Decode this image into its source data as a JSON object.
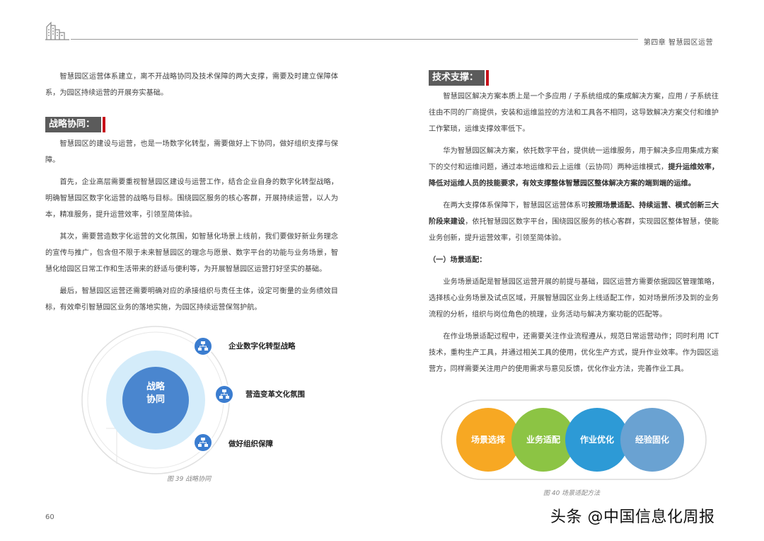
{
  "header": {
    "chapter": "第四章  智慧园区运营"
  },
  "left": {
    "intro": "智慧园区运营体系建立，离不开战略协同及技术保障的两大支撑，需要及时建立保障体系，为园区持续运营的开展夯实基础。",
    "section_title": "战略协同：",
    "p1": "智慧园区的建设与运营，也是一场数字化转型，需要做好上下协同，做好组织支撑与保障。",
    "p2": "首先，企业高层需要重视智慧园区建设与运营工作，结合企业自身的数字化转型战略，明确智慧园区数字化运营的战略与目标。围绕园区服务的核心客群，开展持续运营，以人为本，精准服务，提升运营效率，引领至简体验。",
    "p3": "其次，需要营造数字化运营的文化氛围，如智慧化场景上线前，我们要做好新业务理念的宣传与推广，包含但不限于未来智慧园区的理念与愿景、数字平台的功能与业务场景，智慧化给园区日常工作和生活带来的舒适与便利等，为开展智慧园区运营打好坚实的基础。",
    "p4": "最后，智慧园区运营还需要明确对应的承接组织与责任主体，设定可衡量的业务绩效目标，有效牵引智慧园区业务的落地实施，为园区持续运营保驾护航。"
  },
  "diagram1": {
    "center_label": "战略协同",
    "items": [
      "企业数字化转型战略",
      "营造变革文化氛围",
      "做好组织保障"
    ],
    "caption": "图 39 战略协同"
  },
  "right": {
    "section_title": "技术支撑：",
    "p1": "智慧园区解决方案本质上是一个多应用 / 子系统组成的集成解决方案，应用 / 子系统往往由不同的厂商提供，安装和运维监控的方法和工具各不相同，这导致解决方案交付和维护工作繁琐，运维支撑效率低下。",
    "p2_a": "华为智慧园区解决方案，依托数字平台，提供统一运维服务，用于解决多应用集成方案下的交付和运维问题，通过本地运维和云上运维（云协同）两种运维模式，",
    "p2_b": "提升运维效率，降低对运维人员的技能要求，有效支撑整体智慧园区整体解决方案的端到端的运维。",
    "p3_a": "在两大支撑体系保障下，智慧园区运营体系可",
    "p3_b": "按照场景适配、持续运营、模式创新三大阶段来建设",
    "p3_c": "，依托智慧园区数字平台，围绕园区服务的核心客群，实现园区整体智慧，使能业务创新，提升运营效率，引领至简体验。",
    "sub_head": "（一）场景适配：",
    "p4": "业务场景适配是智慧园区运营开展的前提与基础，园区运营方需要依据园区管理策略，选择核心业务场景及试点区域，开展智慧园区业务上线适配工作，如对场景所涉及到的业务流程的分析，组织与岗位角色的梳理，业务活动与解决方案功能的匹配等。",
    "p5": "在作业场景适配过程中，还需要关注作业流程遵从，规范日常运营动作；同时利用 ICT 技术，重构生产工具，并通过相关工具的使用，优化生产方式，提升作业效率。作为园区运营方，同样需要关注用户的使用需求与意见反馈，优化作业方法，完善作业工具。"
  },
  "diagram2": {
    "circles": [
      "场景选择",
      "业务适配",
      "作业优化",
      "经验固化"
    ],
    "colors": [
      "#f7a823",
      "#8cc444",
      "#2d9ad6",
      "#6aa2d2"
    ],
    "caption": "图 40 场景适配方法"
  },
  "footer": {
    "page_number": "60",
    "watermark": "头条 @中国信息化周报"
  }
}
